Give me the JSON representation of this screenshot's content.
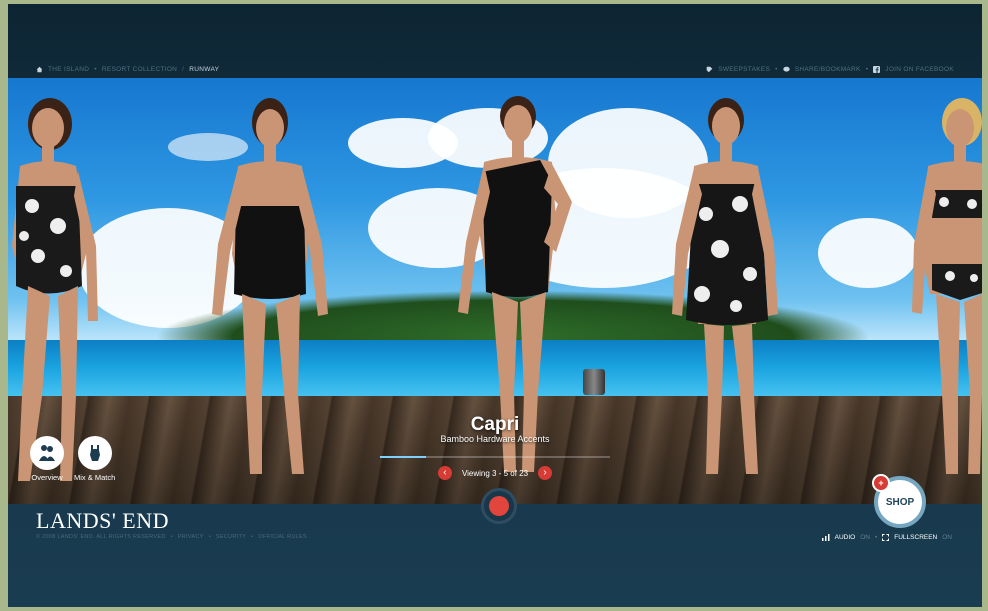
{
  "nav": {
    "breadcrumb": [
      {
        "label": "THE ISLAND"
      },
      {
        "label": "RESORT COLLECTION"
      },
      {
        "label": "RUNWAY",
        "current": true
      }
    ],
    "actions": [
      {
        "label": "SWEEPSTAKES",
        "icon": "tag-icon"
      },
      {
        "label": "SHARE/BOOKMARK",
        "icon": "speech-bubble-icon"
      },
      {
        "label": "JOIN ON FACEBOOK",
        "icon": "facebook-icon"
      }
    ]
  },
  "feature": {
    "name": "Capri",
    "subtitle": "Bamboo Hardware Accents",
    "progress": 0.2
  },
  "pager": {
    "text": "Viewing 3 - 5 of 23",
    "prev_icon": "chevron-left-icon",
    "next_icon": "chevron-right-icon"
  },
  "views": {
    "overview_label": "Overview",
    "mix_label": "Mix & Match"
  },
  "shop": {
    "label": "SHOP",
    "plus": "+"
  },
  "footer": {
    "logo": "LANDS' END",
    "legal": [
      "© 2008 LANDS' END. ALL RIGHTS RESERVED",
      "PRIVACY",
      "SECURITY",
      "OFFICIAL RULES"
    ],
    "audio_label": "AUDIO",
    "audio_state": "ON",
    "fullscreen_label": "FULLSCREEN",
    "fullscreen_state": "ON"
  },
  "colors": {
    "accent_red": "#d63c35",
    "frame_bg": "#163649",
    "outer_bg": "#a9b78c"
  }
}
